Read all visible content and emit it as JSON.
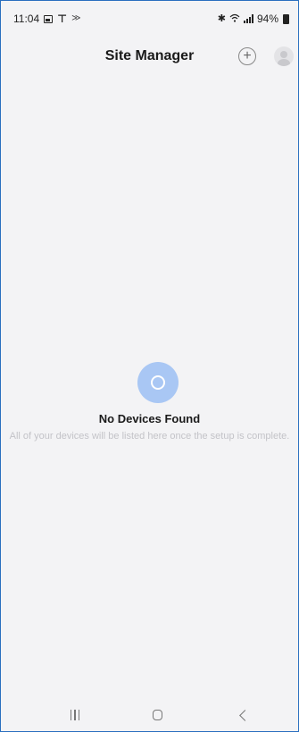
{
  "status_bar": {
    "time": "11:04",
    "battery_percent": "94%",
    "left_icons": [
      "gallery-icon",
      "antenna-icon",
      "nfc-icon"
    ],
    "right_icons": [
      "bluetooth-icon",
      "wifi-icon",
      "signal-icon",
      "battery-icon"
    ]
  },
  "header": {
    "title": "Site Manager",
    "add_icon": "add-circle-icon",
    "avatar_icon": "user-avatar-icon"
  },
  "empty_state": {
    "icon": "empty-device-icon",
    "title": "No Devices Found",
    "description": "All of your devices will be listed here once the setup is complete.",
    "icon_color": "#a9c7f4"
  },
  "nav_bar": {
    "buttons": [
      "recent-apps-icon",
      "home-icon",
      "back-icon"
    ]
  },
  "colors": {
    "background": "#f3f3f5",
    "title_text": "#1a1a1a",
    "muted_text": "#c3c3c8",
    "frame_border": "#2a6fbf"
  }
}
